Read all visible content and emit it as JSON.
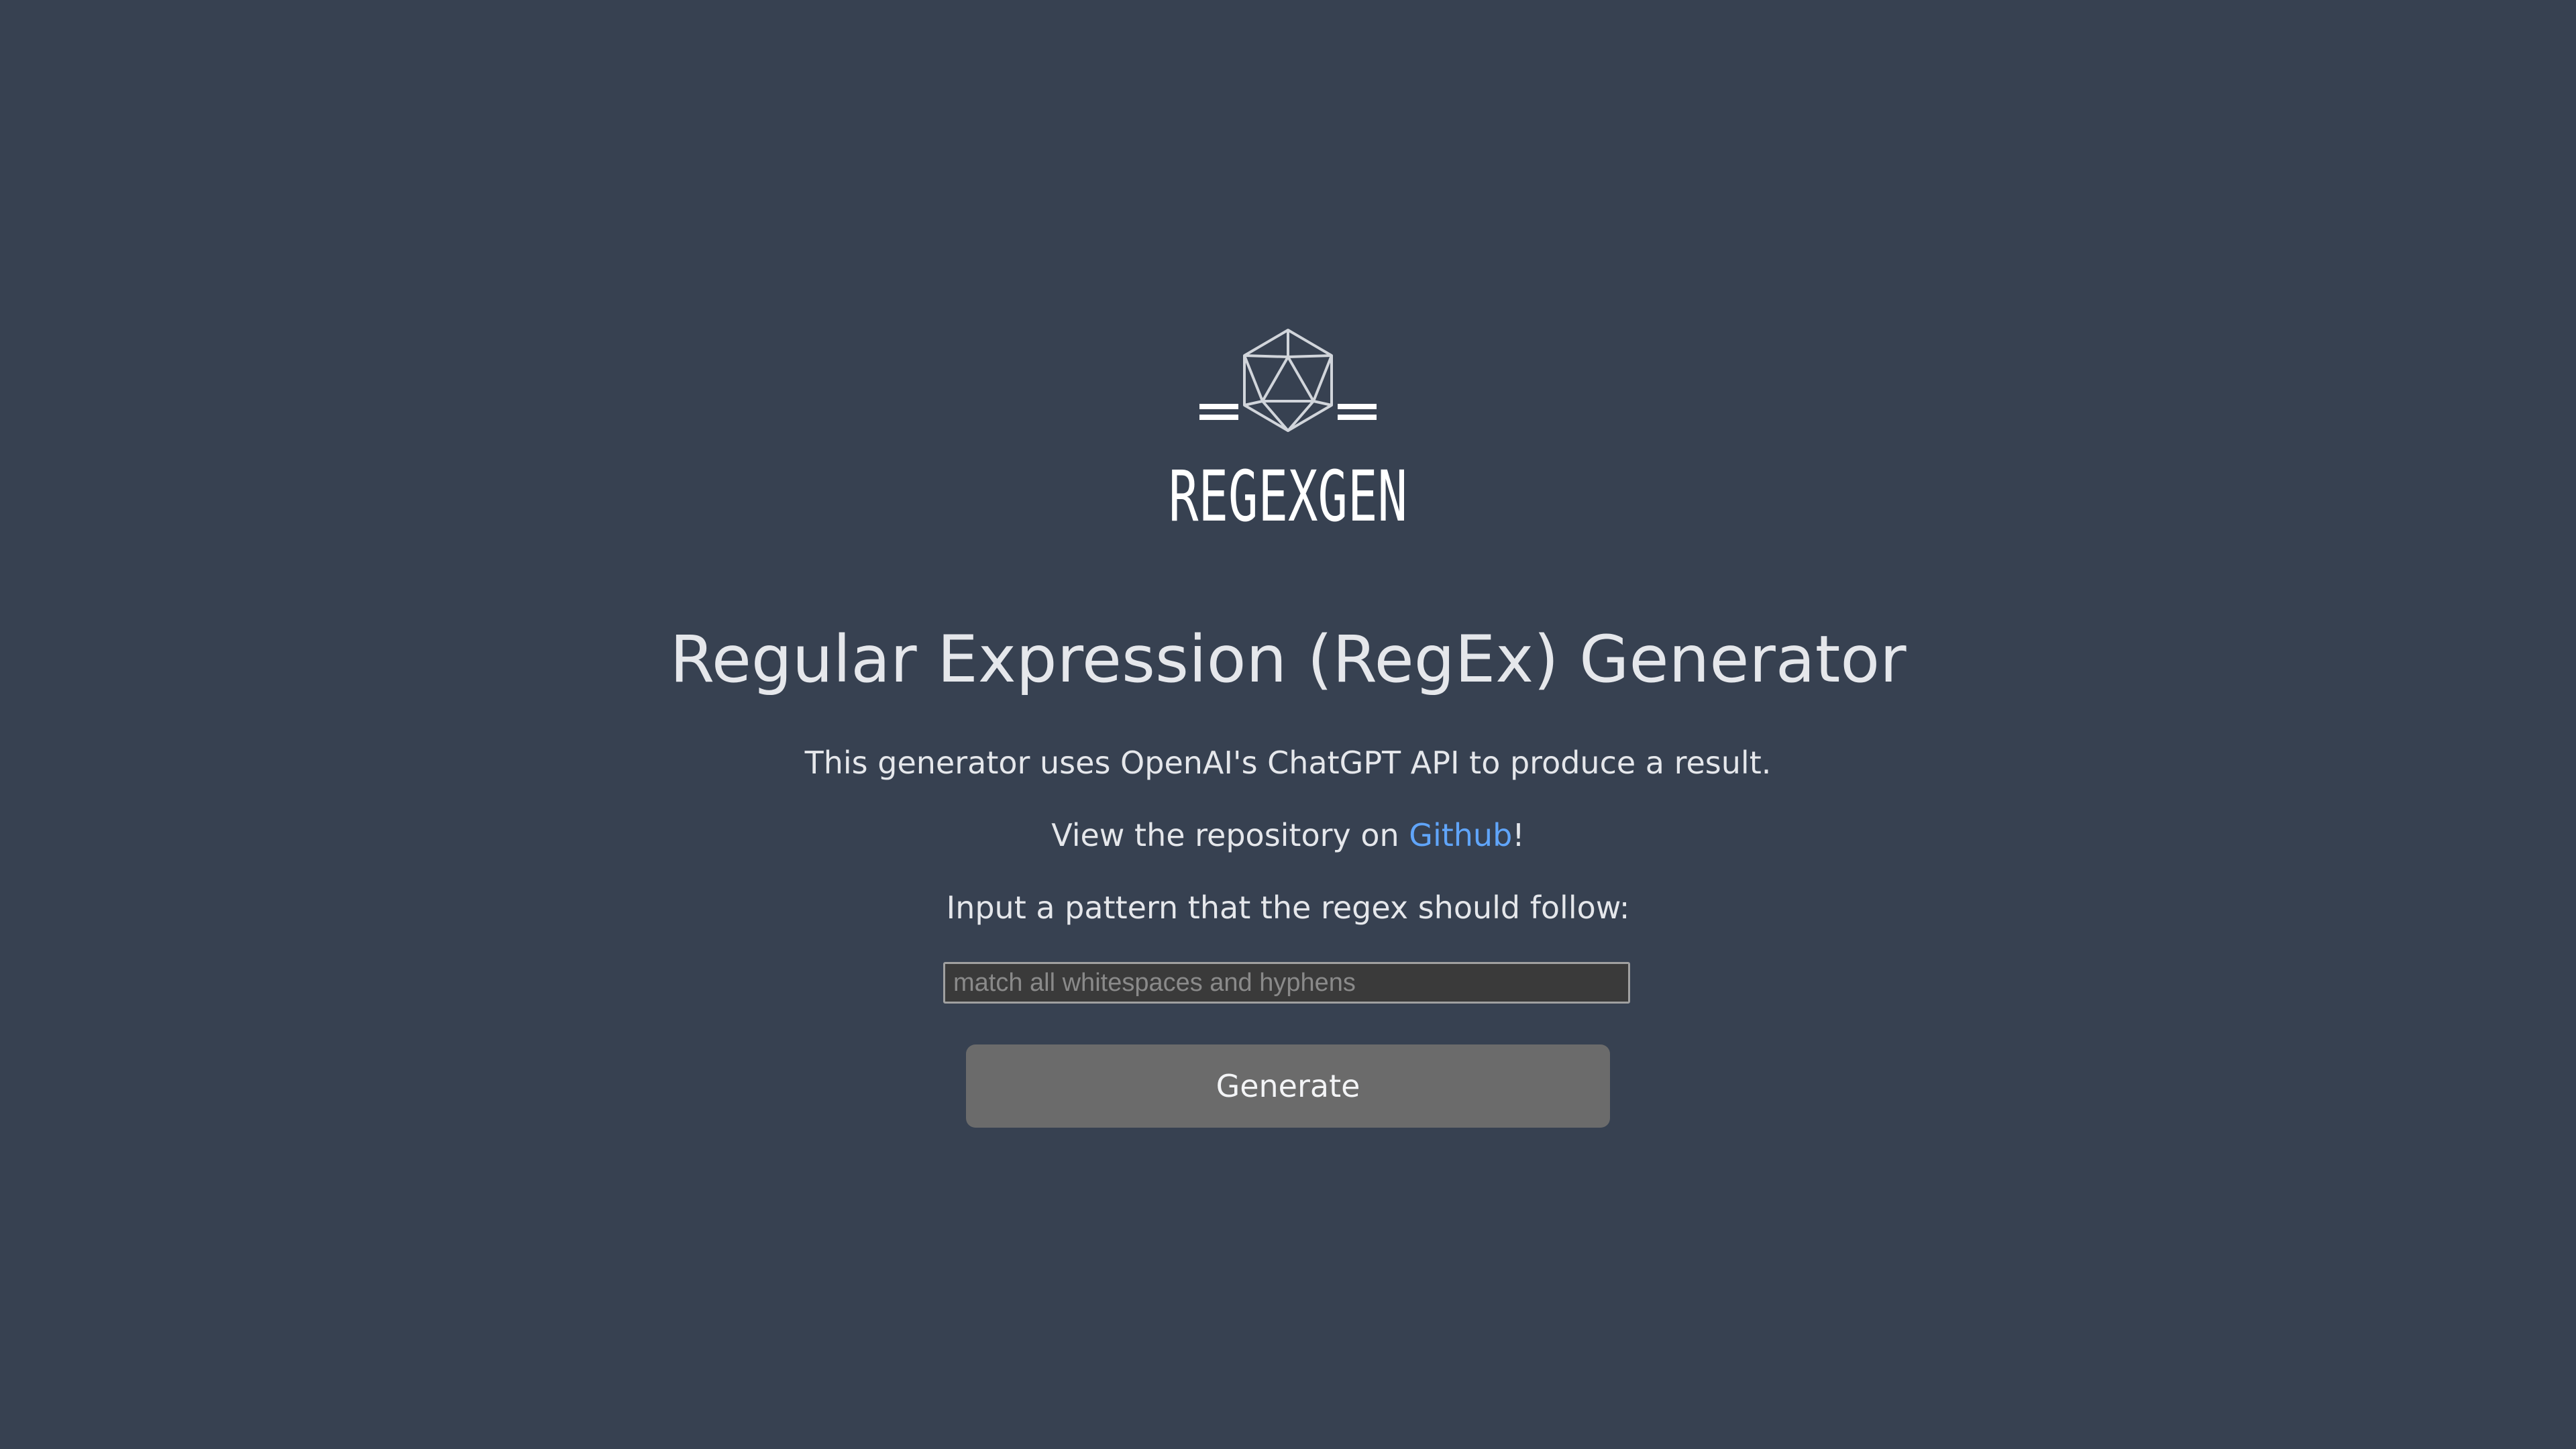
{
  "logo": {
    "text": "REGEXGEN",
    "icon": "icosahedron-icon"
  },
  "page": {
    "title": "Regular Expression (RegEx) Generator",
    "description": "This generator uses OpenAI's ChatGPT API to produce a result.",
    "repo_prefix": "View the repository on ",
    "repo_link_label": "Github",
    "repo_suffix": "!",
    "input_prompt": "Input a pattern that the regex should follow:"
  },
  "form": {
    "input_value": "",
    "input_placeholder": "match all whitespaces and hyphens",
    "generate_label": "Generate"
  },
  "colors": {
    "background": "#374151",
    "text": "#e5e7eb",
    "link": "#60a5fa",
    "button": "#6b6b6b",
    "input_background": "#3a3a3a"
  }
}
